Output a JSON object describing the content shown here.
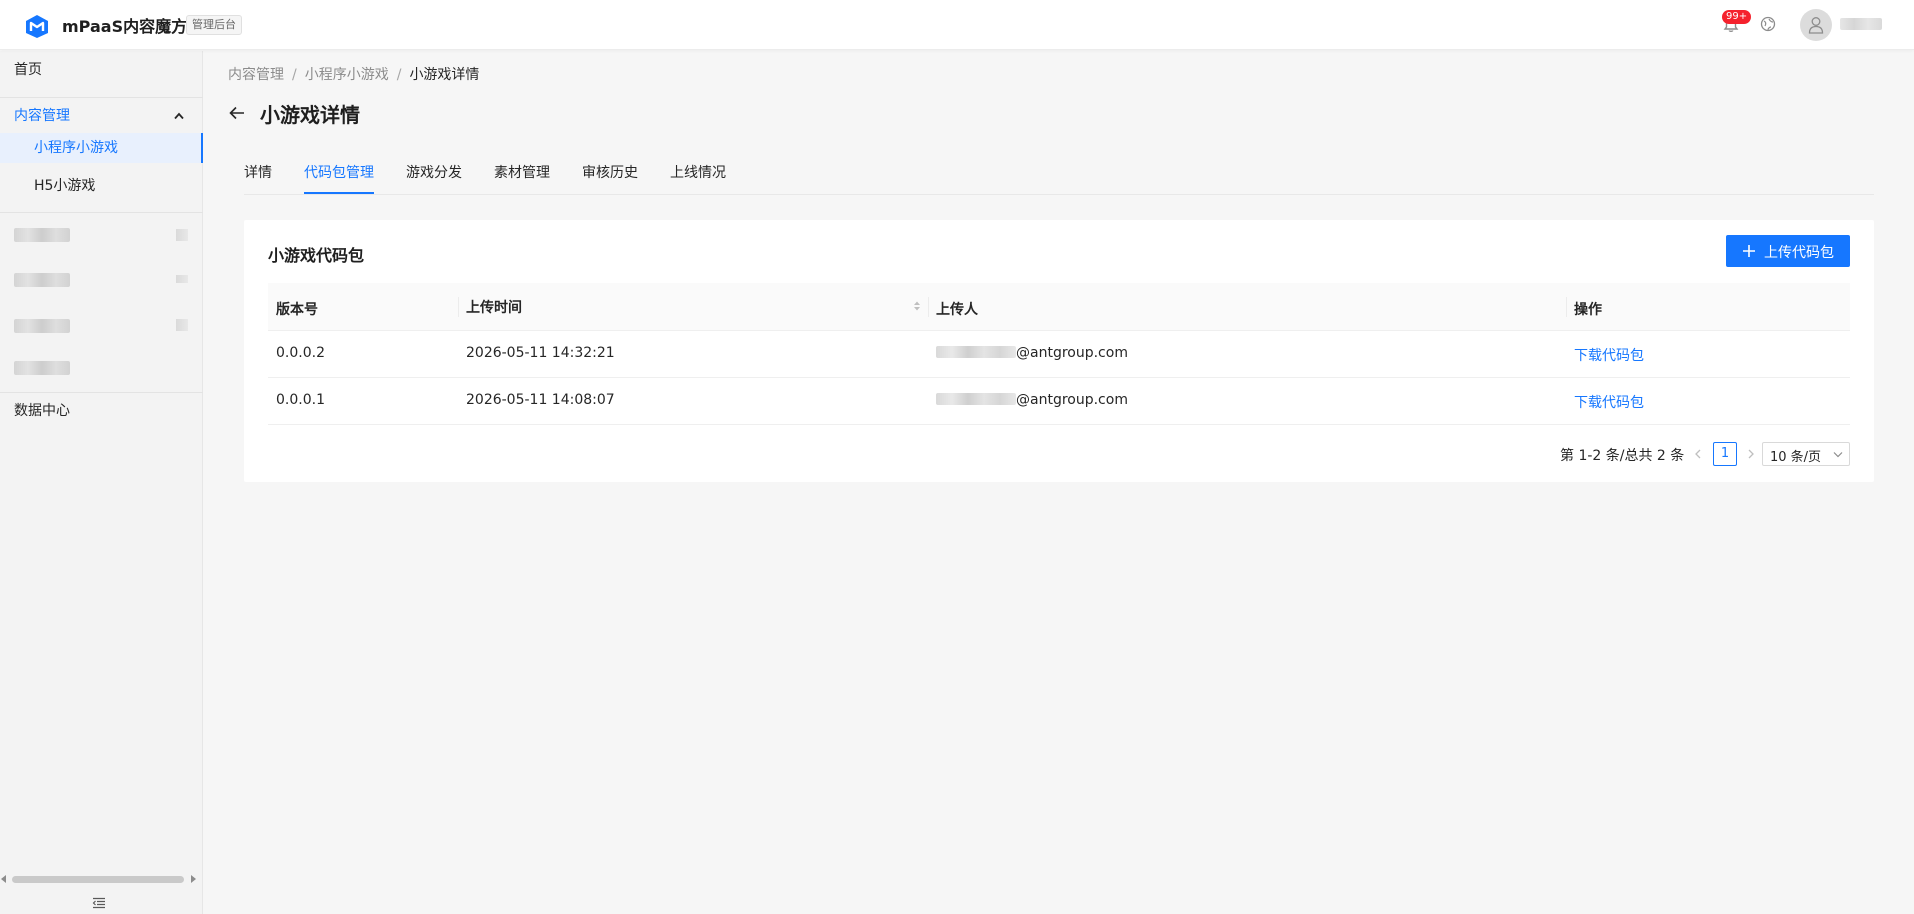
{
  "header": {
    "app_name": "mPaaS内容魔方",
    "admin_tag": "管理后台",
    "notification_count": "99+",
    "icons": [
      "logo-icon",
      "bell-icon",
      "globe-icon",
      "user-icon"
    ]
  },
  "sidebar": {
    "items": [
      {
        "label": "首页"
      },
      {
        "label": "内容管理"
      },
      {
        "label": "小程序小游戏"
      },
      {
        "label": "H5小游戏"
      },
      {
        "label": "数据中心"
      }
    ]
  },
  "breadcrumb": {
    "items": [
      "内容管理",
      "小程序小游戏",
      "小游戏详情"
    ],
    "separator": "/"
  },
  "page": {
    "title": "小游戏详情"
  },
  "tabs": [
    "详情",
    "代码包管理",
    "游戏分发",
    "素材管理",
    "审核历史",
    "上线情况"
  ],
  "active_tab": "代码包管理",
  "card": {
    "title": "小游戏代码包",
    "upload_button": "上传代码包"
  },
  "table": {
    "columns": [
      "版本号",
      "上传时间",
      "上传人",
      "操作"
    ],
    "rows": [
      {
        "version": "0.0.0.2",
        "time": "2026-05-11 14:32:21",
        "uploader_domain": "@antgroup.com",
        "action": "下载代码包"
      },
      {
        "version": "0.0.0.1",
        "time": "2026-05-11 14:08:07",
        "uploader_domain": "@antgroup.com",
        "action": "下载代码包"
      }
    ]
  },
  "pagination": {
    "total_text": "第 1-2 条/总共 2 条",
    "current_page": "1",
    "page_size": "10 条/页"
  },
  "colors": {
    "primary": "#1677ff",
    "badge": "#f5222d",
    "sidebar_bg": "#f3f3f3",
    "page_bg": "#f6f6f6"
  }
}
